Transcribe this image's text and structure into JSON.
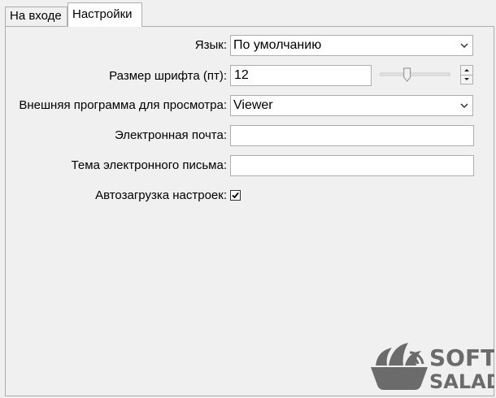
{
  "tabs": [
    {
      "label": "На входе",
      "active": false
    },
    {
      "label": "Настройки",
      "active": true
    }
  ],
  "settings": {
    "language": {
      "label": "Язык:",
      "value": "По умолчанию"
    },
    "font_size": {
      "label": "Размер шрифта (пт):",
      "value": "12",
      "slider_fraction": 0.38
    },
    "viewer": {
      "label": "Внешняя программа для просмотра:",
      "value": "Viewer"
    },
    "email": {
      "label": "Электронная почта:",
      "value": ""
    },
    "email_subject": {
      "label": "Тема электронного письма:",
      "value": ""
    },
    "autoload": {
      "label": "Автозагрузка настроек:",
      "checked": true
    }
  },
  "watermark": {
    "line1": "SOFT",
    "line2": "SALAD",
    "color": "#6b6b6b"
  },
  "colors": {
    "border": "#adadad",
    "background": "#f0f0f0",
    "field": "#ffffff"
  }
}
